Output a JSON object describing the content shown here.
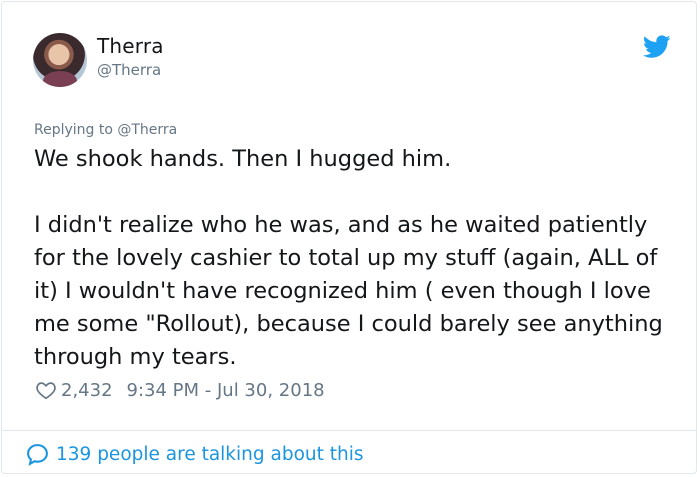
{
  "author": {
    "display_name": "Therra",
    "handle": "@Therra"
  },
  "reply": {
    "replying_to": "Replying to @Therra"
  },
  "tweet": {
    "text": "We shook hands. Then I hugged him.\n\nI didn't realize who he was, and as he waited patiently for the lovely cashier to total up my stuff (again, ALL of it) I wouldn't have recognized him ( even though I love me some \"Rollout), because I could barely see anything through my tears."
  },
  "meta": {
    "likes": "2,432",
    "timestamp": "9:34 PM - Jul 30, 2018"
  },
  "footer": {
    "talking": "139 people are talking about this"
  },
  "colors": {
    "twitter_blue": "#1da1f2",
    "link_blue": "#1b95e0",
    "muted_gray": "#657786",
    "text_dark": "#14171a"
  },
  "icons": [
    "twitter-bird-icon",
    "heart-icon",
    "speech-bubble-icon"
  ]
}
